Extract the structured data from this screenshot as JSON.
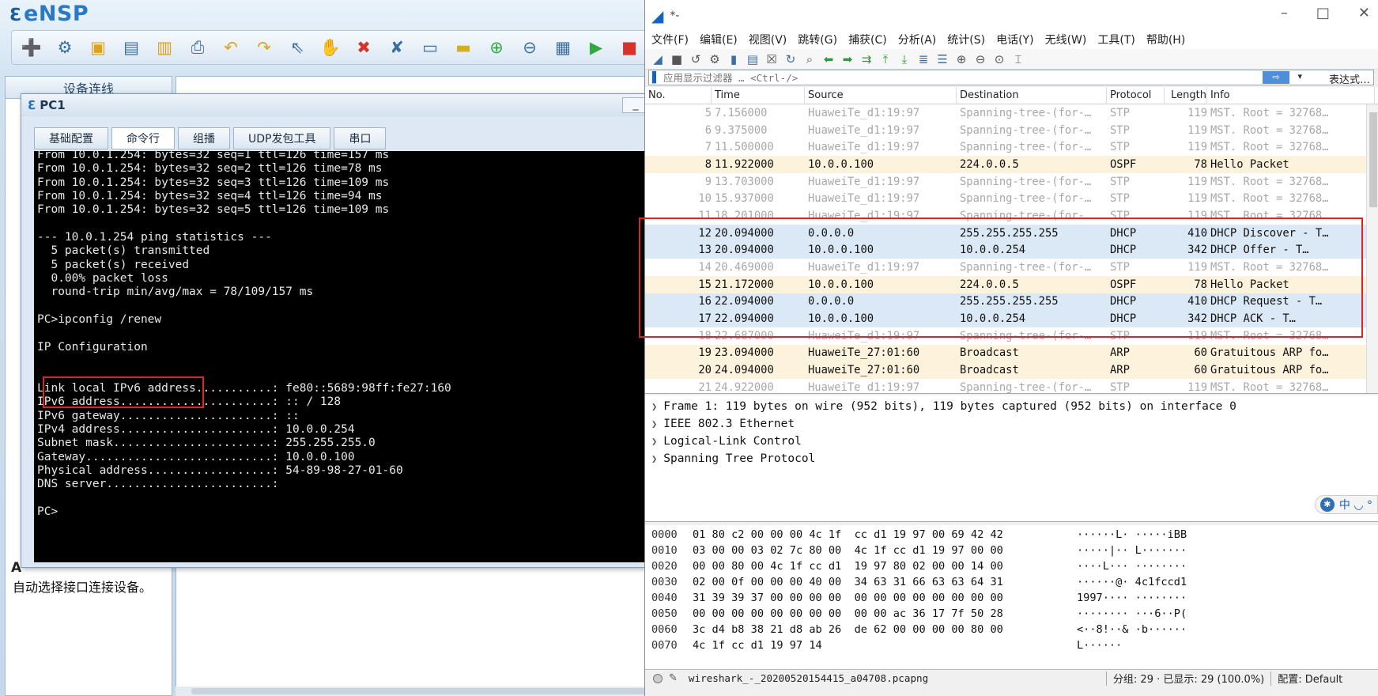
{
  "ensp": {
    "title": "eNSP",
    "tab_devices": "设备连线",
    "hint_letter": "A",
    "hint_text": "自动选择接口连接设备。",
    "toolbar_icons": [
      "new-topology-icon",
      "new-example-icon",
      "open-icon",
      "save-icon",
      "save-as-icon",
      "print-icon",
      "undo-icon",
      "redo-icon",
      "select-icon",
      "pan-icon",
      "delete-icon",
      "delete-link-icon",
      "text-icon",
      "palette-icon",
      "zoom-in-icon",
      "zoom-out-icon",
      "fit-icon",
      "start-icon",
      "stop-icon"
    ]
  },
  "pc1": {
    "title": "PC1",
    "minimize_label": "_",
    "tabs": [
      "基础配置",
      "命令行",
      "组播",
      "UDP发包工具",
      "串口"
    ],
    "active_tab": 1,
    "terminal_lines": [
      "From 10.0.1.254: bytes=32 seq=1 ttl=126 time=157 ms",
      "From 10.0.1.254: bytes=32 seq=2 ttl=126 time=78 ms",
      "From 10.0.1.254: bytes=32 seq=3 ttl=126 time=109 ms",
      "From 10.0.1.254: bytes=32 seq=4 ttl=126 time=94 ms",
      "From 10.0.1.254: bytes=32 seq=5 ttl=126 time=109 ms",
      "",
      "--- 10.0.1.254 ping statistics ---",
      "  5 packet(s) transmitted",
      "  5 packet(s) received",
      "  0.00% packet loss",
      "  round-trip min/avg/max = 78/109/157 ms",
      "",
      "PC>ipconfig /renew",
      "",
      "IP Configuration",
      "",
      "",
      "Link local IPv6 address...........: fe80::5689:98ff:fe27:160",
      "IPv6 address......................: :: / 128",
      "IPv6 gateway......................: ::",
      "IPv4 address......................: 10.0.0.254",
      "Subnet mask.......................: 255.255.255.0",
      "Gateway...........................: 10.0.0.100",
      "Physical address..................: 54-89-98-27-01-60",
      "DNS server........................:",
      "",
      "PC>"
    ]
  },
  "wireshark": {
    "title": "*-",
    "menu": [
      "文件(F)",
      "编辑(E)",
      "视图(V)",
      "跳转(G)",
      "捕获(C)",
      "分析(A)",
      "统计(S)",
      "电话(Y)",
      "无线(W)",
      "工具(T)",
      "帮助(H)"
    ],
    "filter_placeholder": "应用显示过滤器 … <Ctrl-/>",
    "filter_expr_label": "表达式…",
    "columns": [
      "No.",
      "Time",
      "Source",
      "Destination",
      "Protocol",
      "Length",
      "Info"
    ],
    "packets": [
      {
        "no": "5",
        "time": "7.156000",
        "src": "HuaweiTe_d1:19:97",
        "dst": "Spanning-tree-(for-…",
        "proto": "STP",
        "len": "119",
        "info": "MST. Root = 32768…",
        "kind": "stp"
      },
      {
        "no": "6",
        "time": "9.375000",
        "src": "HuaweiTe_d1:19:97",
        "dst": "Spanning-tree-(for-…",
        "proto": "STP",
        "len": "119",
        "info": "MST. Root = 32768…",
        "kind": "stp"
      },
      {
        "no": "7",
        "time": "11.500000",
        "src": "HuaweiTe_d1:19:97",
        "dst": "Spanning-tree-(for-…",
        "proto": "STP",
        "len": "119",
        "info": "MST. Root = 32768…",
        "kind": "stp"
      },
      {
        "no": "8",
        "time": "11.922000",
        "src": "10.0.0.100",
        "dst": "224.0.0.5",
        "proto": "OSPF",
        "len": "78",
        "info": "Hello Packet",
        "kind": "ospf"
      },
      {
        "no": "9",
        "time": "13.703000",
        "src": "HuaweiTe_d1:19:97",
        "dst": "Spanning-tree-(for-…",
        "proto": "STP",
        "len": "119",
        "info": "MST. Root = 32768…",
        "kind": "stp"
      },
      {
        "no": "10",
        "time": "15.937000",
        "src": "HuaweiTe_d1:19:97",
        "dst": "Spanning-tree-(for-…",
        "proto": "STP",
        "len": "119",
        "info": "MST. Root = 32768…",
        "kind": "stp"
      },
      {
        "no": "11",
        "time": "18.201000",
        "src": "HuaweiTe_d1:19:97",
        "dst": "Spanning-tree-(for-…",
        "proto": "STP",
        "len": "119",
        "info": "MST. Root = 32768…",
        "kind": "stp"
      },
      {
        "no": "12",
        "time": "20.094000",
        "src": "0.0.0.0",
        "dst": "255.255.255.255",
        "proto": "DHCP",
        "len": "410",
        "info": "DHCP Discover - T…",
        "kind": "dhcp"
      },
      {
        "no": "13",
        "time": "20.094000",
        "src": "10.0.0.100",
        "dst": "10.0.0.254",
        "proto": "DHCP",
        "len": "342",
        "info": "DHCP Offer    - T…",
        "kind": "dhcp"
      },
      {
        "no": "14",
        "time": "20.469000",
        "src": "HuaweiTe_d1:19:97",
        "dst": "Spanning-tree-(for-…",
        "proto": "STP",
        "len": "119",
        "info": "MST. Root = 32768…",
        "kind": "stp"
      },
      {
        "no": "15",
        "time": "21.172000",
        "src": "10.0.0.100",
        "dst": "224.0.0.5",
        "proto": "OSPF",
        "len": "78",
        "info": "Hello Packet",
        "kind": "ospf"
      },
      {
        "no": "16",
        "time": "22.094000",
        "src": "0.0.0.0",
        "dst": "255.255.255.255",
        "proto": "DHCP",
        "len": "410",
        "info": "DHCP Request  - T…",
        "kind": "dhcp"
      },
      {
        "no": "17",
        "time": "22.094000",
        "src": "10.0.0.100",
        "dst": "10.0.0.254",
        "proto": "DHCP",
        "len": "342",
        "info": "DHCP ACK      - T…",
        "kind": "dhcp"
      },
      {
        "no": "18",
        "time": "22.687000",
        "src": "HuaweiTe_d1:19:97",
        "dst": "Spanning-tree-(for-…",
        "proto": "STP",
        "len": "119",
        "info": "MST. Root = 32768…",
        "kind": "stp"
      },
      {
        "no": "19",
        "time": "23.094000",
        "src": "HuaweiTe_27:01:60",
        "dst": "Broadcast",
        "proto": "ARP",
        "len": "60",
        "info": "Gratuitous ARP fo…",
        "kind": "arp"
      },
      {
        "no": "20",
        "time": "24.094000",
        "src": "HuaweiTe_27:01:60",
        "dst": "Broadcast",
        "proto": "ARP",
        "len": "60",
        "info": "Gratuitous ARP fo…",
        "kind": "arp"
      },
      {
        "no": "21",
        "time": "24.922000",
        "src": "HuaweiTe_d1:19:97",
        "dst": "Spanning-tree-(for-…",
        "proto": "STP",
        "len": "119",
        "info": "MST. Root = 32768…",
        "kind": "stp"
      }
    ],
    "details": [
      "Frame 1: 119 bytes on wire (952 bits), 119 bytes captured (952 bits) on interface 0",
      "IEEE 802.3 Ethernet",
      "Logical-Link Control",
      "Spanning Tree Protocol"
    ],
    "ime_label": "中 ◡ °",
    "bytes": [
      {
        "off": "0000",
        "hex": "01 80 c2 00 00 00 4c 1f  cc d1 19 97 00 69 42 42",
        "ascii": "······L· ·····iBB"
      },
      {
        "off": "0010",
        "hex": "03 00 00 03 02 7c 80 00  4c 1f cc d1 19 97 00 00",
        "ascii": "·····|·· L·······"
      },
      {
        "off": "0020",
        "hex": "00 00 80 00 4c 1f cc d1  19 97 80 02 00 00 14 00",
        "ascii": "····L··· ········"
      },
      {
        "off": "0030",
        "hex": "02 00 0f 00 00 00 40 00  34 63 31 66 63 63 64 31",
        "ascii": "······@· 4c1fccd1"
      },
      {
        "off": "0040",
        "hex": "31 39 39 37 00 00 00 00  00 00 00 00 00 00 00 00",
        "ascii": "1997···· ········"
      },
      {
        "off": "0050",
        "hex": "00 00 00 00 00 00 00 00  00 00 ac 36 17 7f 50 28",
        "ascii": "········ ···6··P("
      },
      {
        "off": "0060",
        "hex": "3c d4 b8 38 21 d8 ab 26  de 62 00 00 00 00 80 00",
        "ascii": "<··8!··& ·b······"
      },
      {
        "off": "0070",
        "hex": "4c 1f cc d1 19 97 14",
        "ascii": "L······"
      }
    ],
    "status": {
      "file": "wireshark_-_20200520154415_a04708.pcapng",
      "packets": "分组: 29 · 已显示: 29 (100.0%)",
      "profile": "配置: Default"
    }
  },
  "colors": {
    "stp_text": "#a8a8a8",
    "dhcp_bg": "#dbe8f6",
    "ospf_bg": "#fdf2dc",
    "highlight_box": "#e02424"
  }
}
